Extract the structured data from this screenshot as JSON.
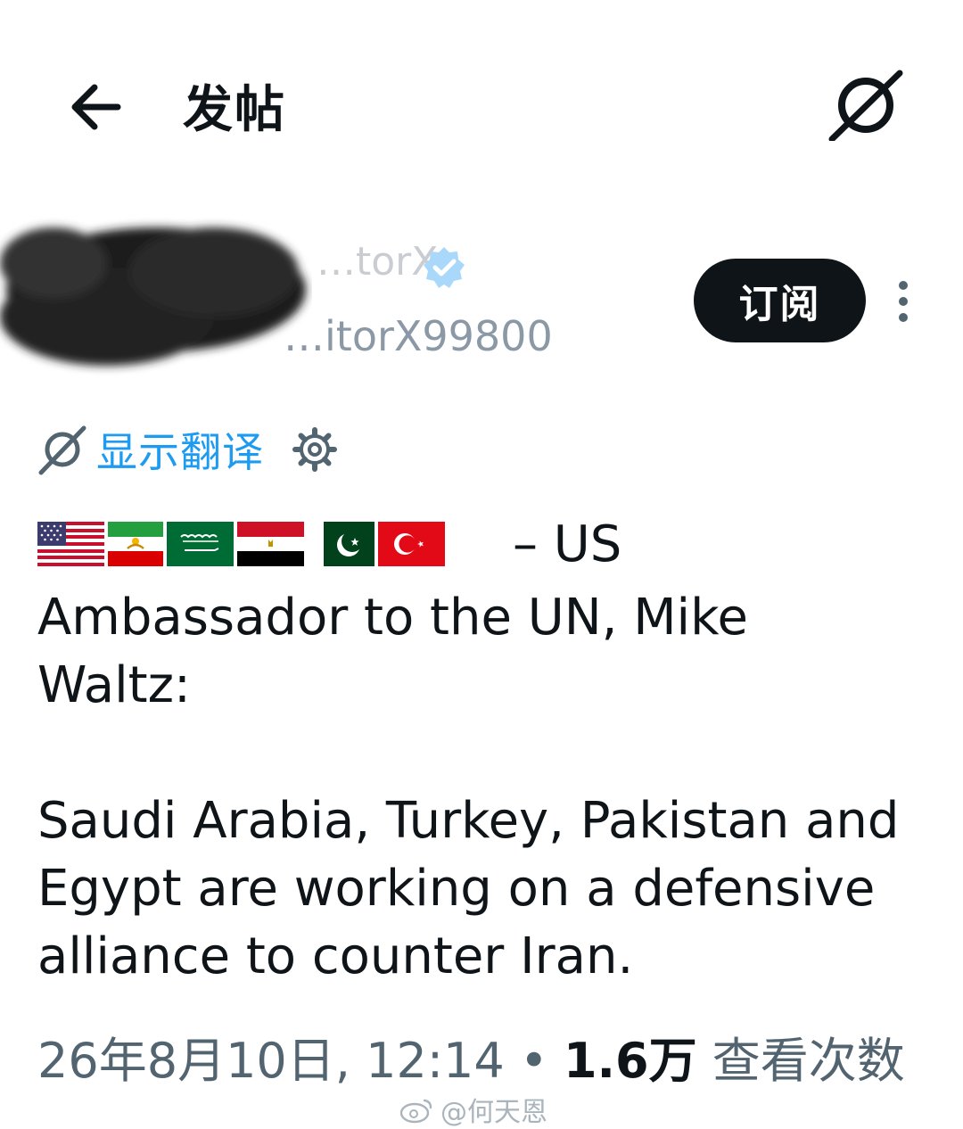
{
  "header": {
    "title": "发帖",
    "back_icon": "arrow-left-icon",
    "grok_icon": "grok-icon"
  },
  "author": {
    "display_name": "…torX",
    "handle": "…itorX99800",
    "verified_icon": "verified-badge-icon"
  },
  "actions": {
    "subscribe_label": "订阅",
    "more_icon": "more-vertical-icon"
  },
  "translate": {
    "label": "显示翻译",
    "icon": "grok-icon",
    "settings_icon": "gear-icon"
  },
  "post": {
    "flags": [
      "us-flag",
      "iran-lion-and-sun-flag",
      "saudi-flag",
      "egypt-flag",
      "pakistan-flag",
      "turkey-flag"
    ],
    "lead": "– US",
    "text": "Ambassador to the UN, Mike\nWaltz:\n\nSaudi Arabia, Turkey, Pakistan and\nEgypt are working on a defensive\nalliance to counter Iran."
  },
  "meta": {
    "timestamp": "26年8月10日, 12:14",
    "separator": "•",
    "views_count": "1.6万",
    "views_label": "查看次数"
  },
  "watermark": {
    "text": "@何天恩"
  },
  "colors": {
    "link": "#1d9bf0",
    "text": "#0f1419",
    "muted": "#536471",
    "button_bg": "#0f1419"
  }
}
